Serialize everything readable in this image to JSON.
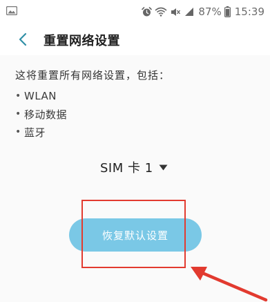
{
  "status_bar": {
    "battery_percent": "87%",
    "time": "15:39",
    "left_icon": "image-notification-icon",
    "icons": [
      "alarm-icon",
      "wifi-icon",
      "mute-icon",
      "signal-icon",
      "battery-icon"
    ]
  },
  "header": {
    "back_icon": "chevron-left-icon",
    "title": "重置网络设置"
  },
  "content": {
    "description": "这将重置所有网络设置，包括：",
    "items": [
      {
        "bullet": "•",
        "label": "WLAN"
      },
      {
        "bullet": "•",
        "label": "移动数据"
      },
      {
        "bullet": "•",
        "label": "蓝牙"
      }
    ],
    "sim_selector": {
      "label": "SIM 卡 1",
      "icon": "dropdown-triangle-icon"
    },
    "reset_button_label": "恢复默认设置"
  },
  "annotation": {
    "box_color": "#e23a2f",
    "arrow_color": "#e23a2f"
  },
  "colors": {
    "button_fill": "#7ac8e6",
    "back_chevron": "#2f8fa6"
  }
}
